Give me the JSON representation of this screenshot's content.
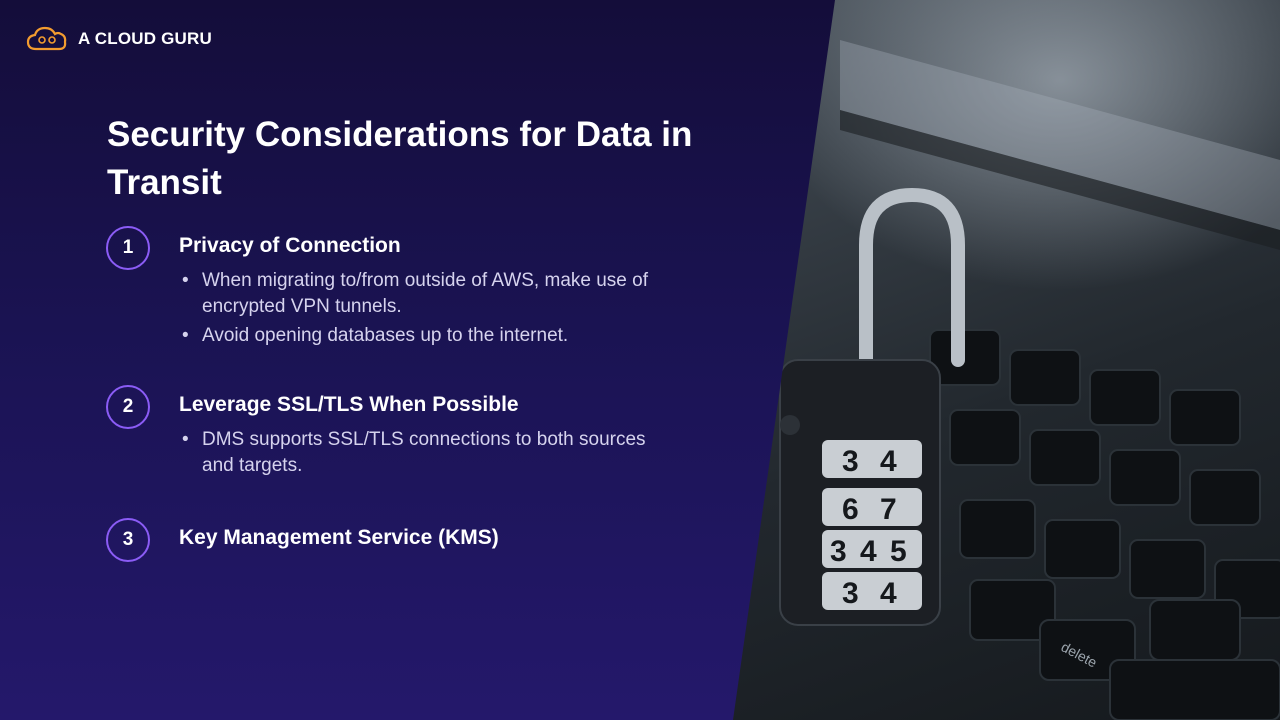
{
  "brand": {
    "name": "A CLOUD GURU",
    "icon": "cloud-logo-icon",
    "accent": "#f39c2f"
  },
  "slide": {
    "title": "Security Considerations for Data in Transit",
    "items": [
      {
        "number": "1",
        "heading": "Privacy of Connection",
        "bullets": [
          "When migrating to/from outside of AWS, make use of encrypted VPN tunnels.",
          "Avoid opening databases up to the internet."
        ]
      },
      {
        "number": "2",
        "heading": "Leverage SSL/TLS When Possible",
        "bullets": [
          "DMS supports SSL/TLS connections to both sources and targets."
        ]
      },
      {
        "number": "3",
        "heading": "Key Management Service (KMS)",
        "bullets": []
      }
    ]
  },
  "photo": {
    "subject": "padlock-on-laptop-keyboard",
    "lock_dials": [
      "3",
      "4",
      "6",
      "7",
      "3",
      "4",
      "5",
      "3",
      "4"
    ],
    "key_label": "delete"
  },
  "colors": {
    "panel": "#1a1352",
    "circle_border": "#8b5cf6",
    "bullet_text": "#d6d3ee"
  }
}
